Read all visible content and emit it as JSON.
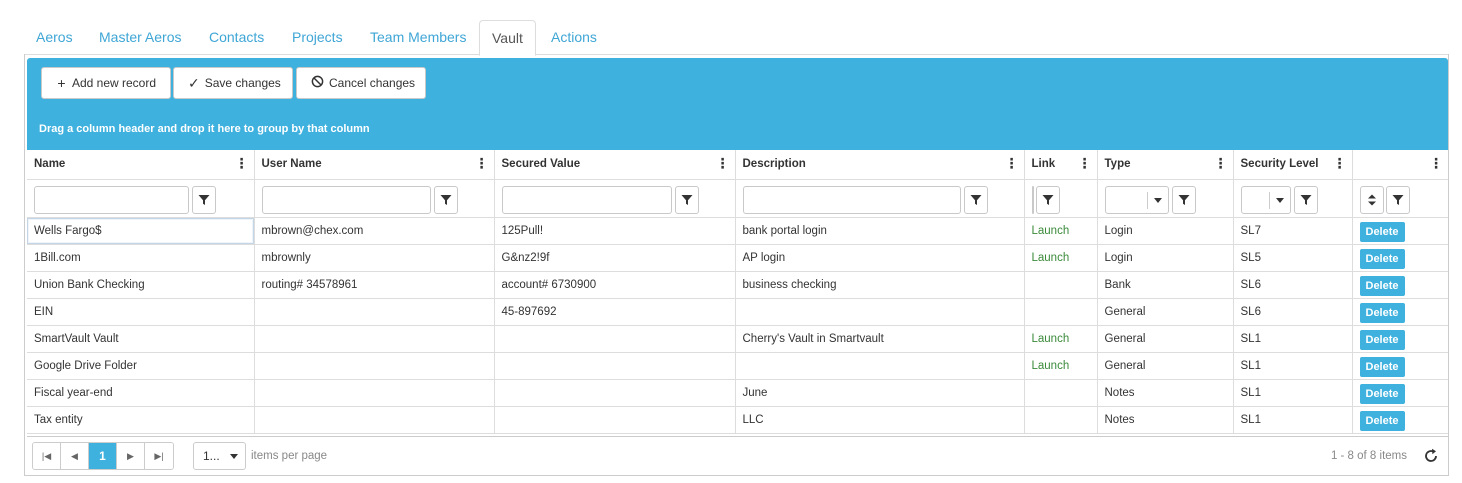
{
  "tabs": [
    "Aeros",
    "Master Aeros",
    "Contacts",
    "Projects",
    "Team Members",
    "Vault",
    "Actions"
  ],
  "active_tab": "Vault",
  "toolbar": {
    "add_label": "Add new record",
    "save_label": "Save changes",
    "cancel_label": "Cancel changes"
  },
  "grouping_hint": "Drag a column header and drop it here to group by that column",
  "columns": [
    "Name",
    "User Name",
    "Secured Value",
    "Description",
    "Link",
    "Type",
    "Security Level",
    ""
  ],
  "rows": [
    {
      "name": "Wells Fargo$",
      "username": "mbrown@chex.com",
      "secured": "125Pull!",
      "description": "bank portal login",
      "link": "Launch",
      "type": "Login",
      "level": "SL7"
    },
    {
      "name": "1Bill.com",
      "username": "mbrownly",
      "secured": "G&nz2!9f",
      "description": "AP login",
      "link": "Launch",
      "type": "Login",
      "level": "SL5"
    },
    {
      "name": "Union Bank Checking",
      "username": "routing# 34578961",
      "secured": "account# 6730900",
      "description": "business checking",
      "link": "",
      "type": "Bank",
      "level": "SL6"
    },
    {
      "name": "EIN",
      "username": "",
      "secured": "45-897692",
      "description": "",
      "link": "",
      "type": "General",
      "level": "SL6"
    },
    {
      "name": "SmartVault Vault",
      "username": "",
      "secured": "",
      "description": "Cherry's Vault in Smartvault",
      "link": "Launch",
      "type": "General",
      "level": "SL1"
    },
    {
      "name": "Google Drive Folder",
      "username": "",
      "secured": "",
      "description": "",
      "link": "Launch",
      "type": "General",
      "level": "SL1"
    },
    {
      "name": "Fiscal year-end",
      "username": "",
      "secured": "",
      "description": "June",
      "link": "",
      "type": "Notes",
      "level": "SL1"
    },
    {
      "name": "Tax entity",
      "username": "",
      "secured": "",
      "description": "LLC",
      "link": "",
      "type": "Notes",
      "level": "SL1"
    }
  ],
  "delete_label": "Delete",
  "pager": {
    "current_page": "1",
    "page_size": "1...",
    "items_per_page_label": "items per page",
    "count_label": "1 - 8 of 8 items"
  },
  "colors": {
    "accent": "#3eb1de",
    "tab_link": "#3fa6d6",
    "launch_link": "#3a8a3a"
  }
}
